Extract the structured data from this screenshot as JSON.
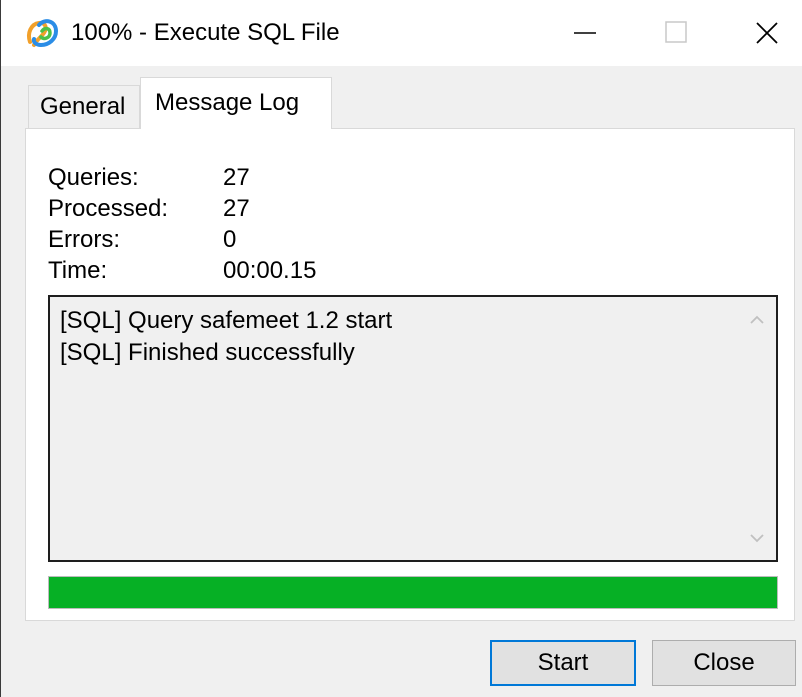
{
  "window": {
    "title": "100% - Execute SQL File"
  },
  "tabs": [
    {
      "label": "General",
      "active": false
    },
    {
      "label": "Message Log",
      "active": true
    }
  ],
  "stats": {
    "queries": {
      "label": "Queries:",
      "value": "27"
    },
    "processed": {
      "label": "Processed:",
      "value": "27"
    },
    "errors": {
      "label": "Errors:",
      "value": "0"
    },
    "time": {
      "label": "Time:",
      "value": "00:00.15"
    }
  },
  "log": [
    "[SQL] Query safemeet 1.2 start",
    "[SQL] Finished successfully"
  ],
  "progress": {
    "percent": 100,
    "color": "#06b025"
  },
  "buttons": {
    "start": "Start",
    "close": "Close"
  },
  "icons": {
    "app": "navicat-app-icon",
    "minimize": "minimize-icon",
    "maximize": "maximize-icon",
    "close": "close-icon",
    "scroll_up": "chevron-up-icon",
    "scroll_down": "chevron-down-icon"
  },
  "colors": {
    "accent": "#0078d7",
    "progress": "#06b025"
  }
}
